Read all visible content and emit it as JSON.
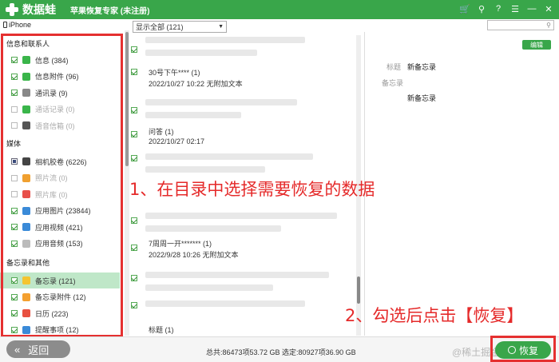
{
  "app": {
    "logo_name": "数据蛙",
    "subtitle": "苹果恢复专家 (未注册)"
  },
  "device": {
    "name": "iPhone"
  },
  "sidebar": {
    "sections": [
      {
        "title": "信息和联系人",
        "items": [
          {
            "label": "信息 (384)",
            "icon": "message-icon",
            "icon_color": "#3ab54a",
            "state": "on"
          },
          {
            "label": "信息附件 (96)",
            "icon": "message-attachment-icon",
            "icon_color": "#3ab54a",
            "state": "on"
          },
          {
            "label": "通讯录 (9)",
            "icon": "contacts-icon",
            "icon_color": "#888888",
            "state": "on"
          },
          {
            "label": "通话记录 (0)",
            "icon": "phone-icon",
            "icon_color": "#3ab54a",
            "state": "off"
          },
          {
            "label": "语音信箱 (0)",
            "icon": "voicemail-icon",
            "icon_color": "#555555",
            "state": "off"
          }
        ]
      },
      {
        "title": "媒体",
        "items": [
          {
            "label": "相机胶卷 (6226)",
            "icon": "camera-icon",
            "icon_color": "#444444",
            "state": "part"
          },
          {
            "label": "照片流 (0)",
            "icon": "photostream-icon",
            "icon_color": "#f0a030",
            "state": "off"
          },
          {
            "label": "照片库 (0)",
            "icon": "photo-library-icon",
            "icon_color": "#e8504a",
            "state": "off"
          },
          {
            "label": "应用图片 (23844)",
            "icon": "app-photo-icon",
            "icon_color": "#3a8ad8",
            "state": "on"
          },
          {
            "label": "应用视频 (421)",
            "icon": "app-video-icon",
            "icon_color": "#3a8ad8",
            "state": "on"
          },
          {
            "label": "应用音频 (153)",
            "icon": "app-audio-icon",
            "icon_color": "#bbbbbb",
            "state": "on"
          }
        ]
      },
      {
        "title": "备忘录和其他",
        "items": [
          {
            "label": "备忘录 (121)",
            "icon": "notes-icon",
            "icon_color": "#f4c430",
            "state": "on",
            "selected": true
          },
          {
            "label": "备忘录附件 (12)",
            "icon": "notes-attachment-icon",
            "icon_color": "#f4a030",
            "state": "on"
          },
          {
            "label": "日历 (223)",
            "icon": "calendar-icon",
            "icon_color": "#e85040",
            "state": "on"
          },
          {
            "label": "提醒事项 (12)",
            "icon": "reminders-icon",
            "icon_color": "#3a8ad8",
            "state": "on"
          }
        ]
      }
    ]
  },
  "annotations": {
    "step1": "1、在目录中选择需要恢复的数据",
    "step2": "2、勾选后点击【恢复】"
  },
  "list": {
    "filter_value": "显示全部 (121)",
    "rows": [
      {
        "title": "30号下午**** (1)",
        "meta": "2022/10/27 10:22   无附加文本"
      },
      {
        "title": "问答 (1)",
        "meta": "2022/10/27 02:17"
      },
      {
        "title": "7周周一开******* (1)",
        "meta": "2022/9/28 10:26   无附加文本"
      },
      {
        "title": "标题 (1)",
        "meta": ""
      }
    ]
  },
  "detail": {
    "edit_label": "编辑",
    "title_label": "标题",
    "title_value": "新备忘录",
    "note_label": "备忘录",
    "note_value": "新备忘录"
  },
  "footer": {
    "back_label": "返回",
    "stats": "总共:86473项53.72 GB 选定:80927项36.90 GB",
    "watermark": "@稀土掘金技术社区",
    "recover_label": "恢复"
  },
  "colors": {
    "brand_green": "#39a64a",
    "annotation_red": "#e53030",
    "selected_row": "#bfe7c8"
  }
}
